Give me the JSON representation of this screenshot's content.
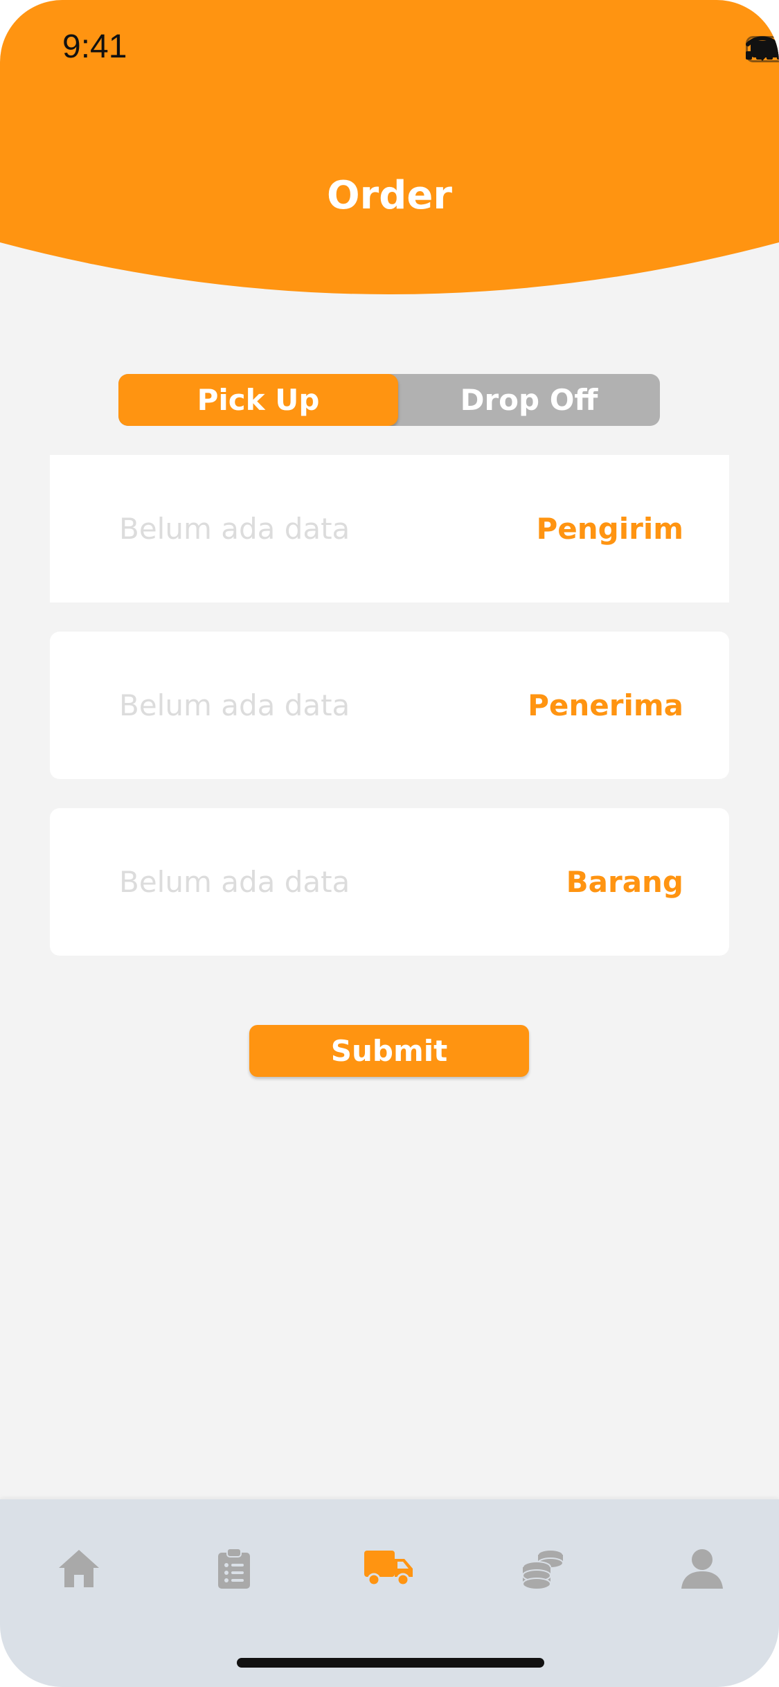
{
  "status_bar": {
    "time": "9:41"
  },
  "header": {
    "title": "Order"
  },
  "segment": {
    "active": "Pick Up",
    "inactive": "Drop Off"
  },
  "cards": [
    {
      "placeholder": "Belum ada data",
      "label": "Pengirim"
    },
    {
      "placeholder": "Belum ada data",
      "label": "Penerima"
    },
    {
      "placeholder": "Belum ada data",
      "label": "Barang"
    }
  ],
  "submit": {
    "label": "Submit"
  },
  "bottom_nav": {
    "items": [
      {
        "icon": "home-icon",
        "active": false
      },
      {
        "icon": "clipboard-list-icon",
        "active": false
      },
      {
        "icon": "truck-icon",
        "active": true
      },
      {
        "icon": "coins-icon",
        "active": false
      },
      {
        "icon": "user-icon",
        "active": false
      }
    ]
  },
  "colors": {
    "accent": "#ff9411",
    "background": "#f3f3f3",
    "inactive_segment": "#b1b1b1",
    "nav_background": "#dae0e7",
    "nav_inactive_icon": "#a9a9a9"
  }
}
